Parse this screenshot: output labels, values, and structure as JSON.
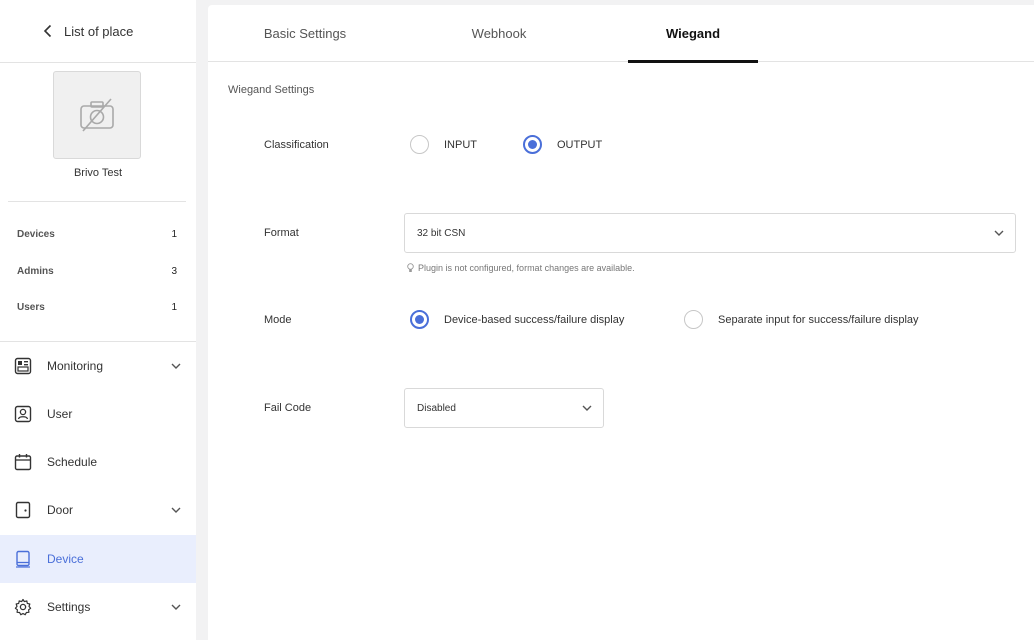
{
  "sidebar": {
    "back_label": "List of place",
    "place_name": "Brivo Test",
    "stats": [
      {
        "label": "Devices",
        "value": "1"
      },
      {
        "label": "Admins",
        "value": "3"
      },
      {
        "label": "Users",
        "value": "1"
      }
    ],
    "nav": [
      {
        "label": "Monitoring",
        "icon": "monitoring-icon",
        "has_caret": true,
        "active": false
      },
      {
        "label": "User",
        "icon": "user-icon",
        "has_caret": false,
        "active": false
      },
      {
        "label": "Schedule",
        "icon": "calendar-icon",
        "has_caret": false,
        "active": false
      },
      {
        "label": "Door",
        "icon": "door-icon",
        "has_caret": true,
        "active": false
      },
      {
        "label": "Device",
        "icon": "device-icon",
        "has_caret": false,
        "active": true
      },
      {
        "label": "Settings",
        "icon": "gear-icon",
        "has_caret": true,
        "active": false
      }
    ]
  },
  "tabs": [
    {
      "label": "Basic Settings",
      "active": false
    },
    {
      "label": "Webhook",
      "active": false
    },
    {
      "label": "Wiegand",
      "active": true
    }
  ],
  "wiegand": {
    "section_title": "Wiegand Settings",
    "classification": {
      "label": "Classification",
      "options": [
        "INPUT",
        "OUTPUT"
      ],
      "selected": "OUTPUT"
    },
    "format": {
      "label": "Format",
      "value": "32 bit CSN",
      "hint": "Plugin is not configured, format changes are available."
    },
    "mode": {
      "label": "Mode",
      "options": [
        "Device-based success/failure display",
        "Separate input for success/failure display"
      ],
      "selected": "Device-based success/failure display"
    },
    "fail_code": {
      "label": "Fail Code",
      "value": "Disabled"
    }
  },
  "colors": {
    "accent": "#4a6fd9",
    "active_nav_bg": "#e9eefd",
    "page_bg": "#f2f2f3"
  }
}
